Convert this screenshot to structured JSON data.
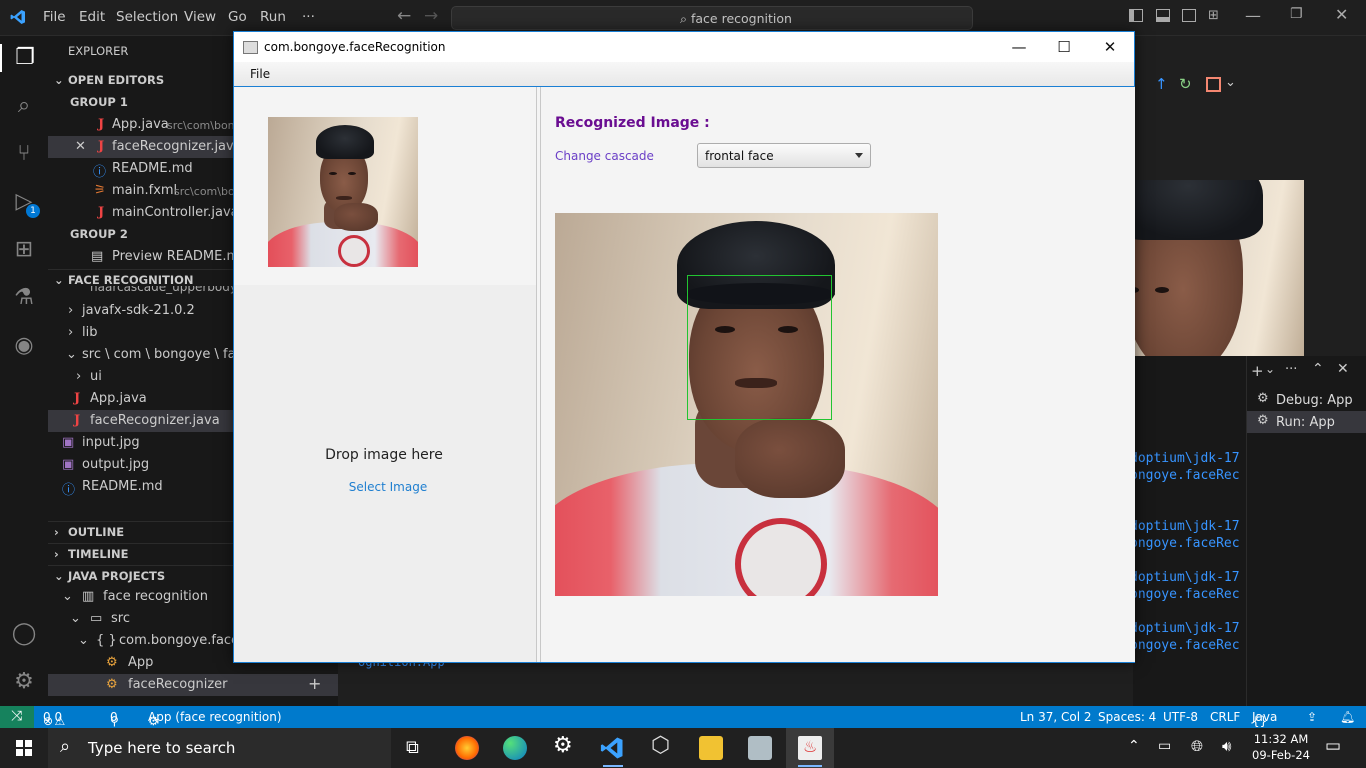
{
  "vscode": {
    "menu": [
      "File",
      "Edit",
      "Selection",
      "View",
      "Go",
      "Run",
      "···"
    ],
    "search": "face recognition",
    "explorer_title": "EXPLORER",
    "sections": {
      "open_editors": "OPEN EDITORS",
      "group1": "GROUP 1",
      "group2": "GROUP 2",
      "face_recognition": "FACE RECOGNITION",
      "outline": "OUTLINE",
      "timeline": "TIMELINE",
      "java_projects": "JAVA PROJECTS"
    },
    "open_editors": [
      {
        "name": "App.java",
        "hint": "src\\com\\bon"
      },
      {
        "name": "faceRecognizer.java",
        "hint": "s"
      },
      {
        "name": "README.md",
        "hint": ""
      },
      {
        "name": "main.fxml",
        "hint": "src\\com\\bo"
      },
      {
        "name": "mainController.java",
        "hint": "s"
      }
    ],
    "group2_items": [
      "Preview README.md"
    ],
    "tree": [
      "haarcascade_upperbody...",
      "javafx-sdk-21.0.2",
      "lib",
      "src \\ com \\ bongoye \\ faceR",
      "ui",
      "App.java",
      "faceRecognizer.java",
      "input.jpg",
      "output.jpg",
      "README.md"
    ],
    "java_projects": [
      "face recognition",
      "src",
      "com.bongoye.faceR",
      "App",
      "faceRecognizer"
    ],
    "debug_badge": "1",
    "run_items": [
      "Debug: App",
      "Run: App"
    ],
    "terminal_lines": [
      "doptium\\jdk-17",
      "ongoye.faceRec",
      "doptium\\jdk-17",
      "ongoye.faceRec",
      "doptium\\jdk-17",
      "ongoye.faceRec",
      "doptium\\jdk-17",
      "ongoye.faceRec"
    ],
    "terminal_bottom": "ognition.App",
    "status": {
      "errors": "0",
      "warnings": "0",
      "ports": "0",
      "run_config": "App (face recognition)",
      "position": "Ln 37, Col 2",
      "spaces": "Spaces: 4",
      "encoding": "UTF-8",
      "eol": "CRLF",
      "language": "Java"
    }
  },
  "fx_window": {
    "title": "com.bongoye.faceRecognition",
    "menu_file": "File",
    "drop_text": "Drop image here",
    "select_image": "Select Image",
    "recognized_title": "Recognized Image :",
    "change_cascade": "Change cascade",
    "cascade_value": "frontal face",
    "controls": {
      "minimize": "—",
      "maximize": "☐",
      "close": "✕"
    }
  },
  "taskbar": {
    "search_placeholder": "Type here to search",
    "time": "11:32 AM",
    "date": "09-Feb-24"
  },
  "colors": {
    "accent_blue": "#007acc",
    "recognized_title": "#6a0d91",
    "link": "#1f7fd0",
    "face_box": "#22c431"
  }
}
